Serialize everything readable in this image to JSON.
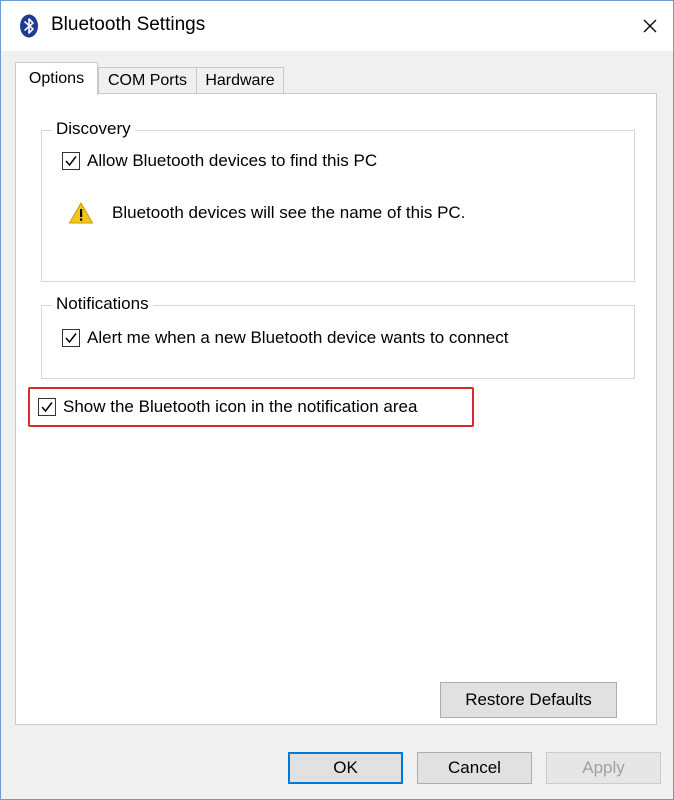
{
  "window": {
    "title": "Bluetooth Settings",
    "close_glyph": "✕"
  },
  "tabs": [
    {
      "label": "Options",
      "active": true
    },
    {
      "label": "COM Ports",
      "active": false
    },
    {
      "label": "Hardware",
      "active": false
    }
  ],
  "discovery": {
    "legend": "Discovery",
    "allow_label": "Allow Bluetooth devices to find this PC",
    "allow_checked": true,
    "warning_text": "Bluetooth devices will see the name of this PC."
  },
  "notifications": {
    "legend": "Notifications",
    "alert_label": "Alert me when a new Bluetooth device wants to connect",
    "alert_checked": true
  },
  "show_icon": {
    "label": "Show the Bluetooth icon in the notification area",
    "checked": true,
    "highlight_color": "#d42b2b"
  },
  "buttons": {
    "restore_defaults": "Restore Defaults",
    "ok": "OK",
    "cancel": "Cancel",
    "apply": "Apply"
  },
  "colors": {
    "accent": "#0078d7",
    "bluetooth_icon": "#1f3a93",
    "warning": "#f5c518"
  }
}
